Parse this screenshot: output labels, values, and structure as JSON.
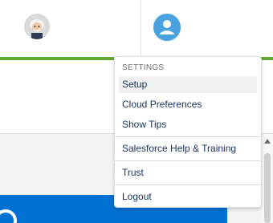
{
  "menu": {
    "section_header": "SETTINGS",
    "items": [
      {
        "label": "Setup"
      },
      {
        "label": "Cloud Preferences"
      },
      {
        "label": "Show Tips"
      },
      {
        "label": "Salesforce Help & Training"
      },
      {
        "label": "Trust"
      },
      {
        "label": "Logout"
      }
    ]
  },
  "colors": {
    "accent_green": "#5ea932",
    "profile_blue": "#4aa3df",
    "panel_blue": "#0070d2",
    "menu_text": "#16325c"
  },
  "icons": {
    "left_avatar": "einstein-avatar-icon",
    "right_avatar": "user-profile-icon",
    "panel_logo": "cloud-logo-icon"
  }
}
